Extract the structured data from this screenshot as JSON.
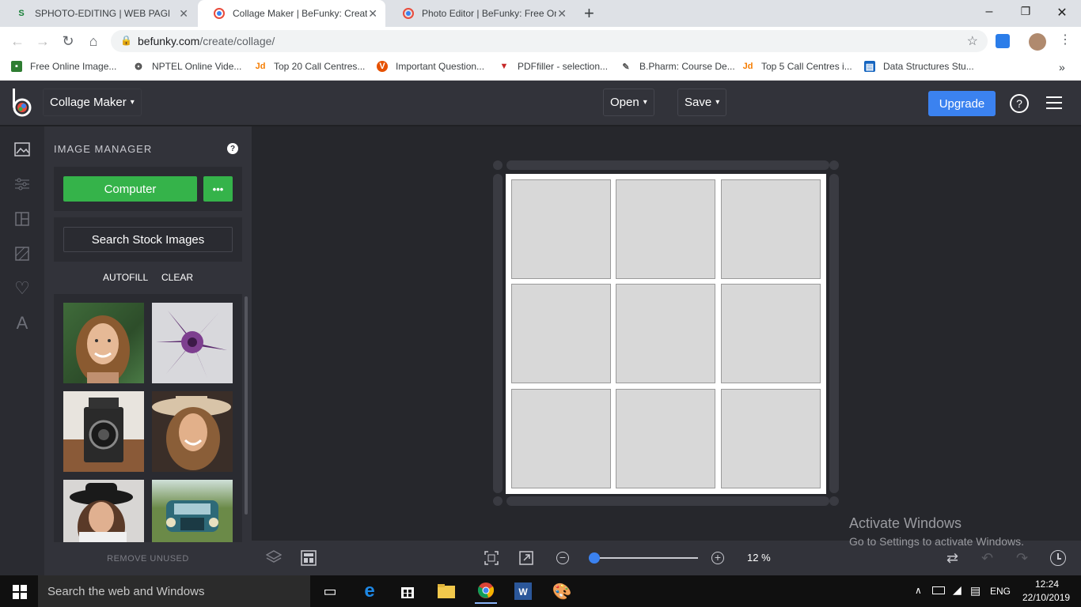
{
  "browser": {
    "tabs": [
      {
        "title": "SPHOTO-EDITING | WEB PAGE",
        "favicon": "S"
      },
      {
        "title": "Collage Maker | BeFunky: Create",
        "favicon": "b"
      },
      {
        "title": "Photo Editor | BeFunky: Free Onli",
        "favicon": "b"
      }
    ],
    "new_tab": "+",
    "url_host": "befunky.com",
    "url_path": "/create/collage/",
    "bookmarks": [
      {
        "label": "Free Online Image...",
        "icon": "image-icon",
        "color": "#2e7d32"
      },
      {
        "label": "NPTEL Online Vide...",
        "icon": "nptel-icon",
        "color": "#444444"
      },
      {
        "label": "Top 20 Call Centres...",
        "icon": "jd-icon",
        "color": "#f57c00"
      },
      {
        "label": "Important Question...",
        "icon": "v-icon",
        "color": "#e65100"
      },
      {
        "label": "PDFfiller - selection...",
        "icon": "pdffiller-icon",
        "color": "#c62828"
      },
      {
        "label": "B.Pharm: Course De...",
        "icon": "pharm-icon",
        "color": "#555555"
      },
      {
        "label": "Top 5 Call Centres i...",
        "icon": "jd-icon",
        "color": "#f57c00"
      },
      {
        "label": "Data Structures Stu...",
        "icon": "doc-icon",
        "color": "#1565c0"
      }
    ],
    "more_bookmarks": "»"
  },
  "app": {
    "title": "Collage Maker",
    "open_label": "Open",
    "save_label": "Save",
    "upgrade_label": "Upgrade",
    "help_label": "?",
    "accent": "#3b82f0"
  },
  "panel": {
    "title": "IMAGE MANAGER",
    "computer_label": "Computer",
    "more_label": "•••",
    "search_label": "Search Stock Images",
    "autofill_label": "AUTOFILL",
    "clear_label": "CLEAR",
    "remove_unused_label": "REMOVE UNUSED",
    "green": "#35b34a",
    "thumbnails": [
      "woman-smiling",
      "purple-succulent",
      "vintage-camera",
      "woman-hat-laughing",
      "woman-black-hat",
      "vintage-truck"
    ]
  },
  "canvas": {
    "cells": 9,
    "cell_color": "#d8d8d8"
  },
  "bottom": {
    "zoom_percent": 12,
    "zoom_label": "12 %",
    "zoom_fraction": 0.05
  },
  "watermark": {
    "title": "Activate Windows",
    "subtitle": "Go to Settings to activate Windows."
  },
  "taskbar": {
    "search_placeholder": "Search the web and Windows",
    "language": "ENG",
    "time": "12:24",
    "date": "22/10/2019"
  }
}
